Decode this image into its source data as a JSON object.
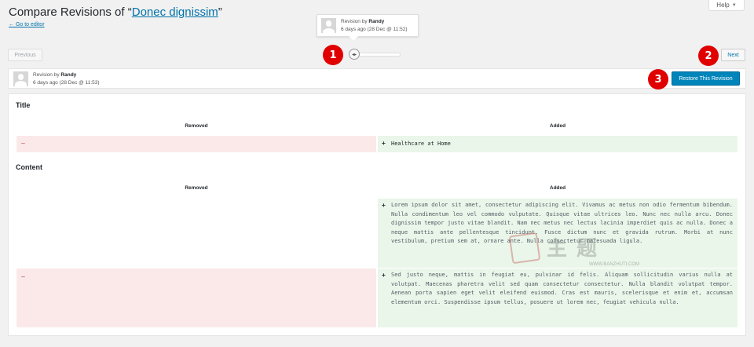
{
  "help": {
    "label": "Help",
    "caret": "▼"
  },
  "header": {
    "title_prefix": "Compare Revisions of “",
    "post_title": "Donec dignissim",
    "title_suffix": "”",
    "go_to_editor": "← Go to editor"
  },
  "tooltip": {
    "label": "Revision by",
    "author": "Randy",
    "time": "6 days ago (28 Dec @ 11:52)"
  },
  "nav": {
    "previous_label": "Previous",
    "next_label": "Next",
    "slider_handle_glyph": "◂▸"
  },
  "badges": [
    "1",
    "2",
    "3"
  ],
  "revision": {
    "label": "Revision by",
    "author": "Randy",
    "time": "6 days ago (28 Dec @ 11:53)",
    "restore_label": "Restore This Revision"
  },
  "diff": {
    "title_section": {
      "heading": "Title",
      "removed_header": "Removed",
      "added_header": "Added",
      "removed_mark": "–",
      "added_mark": "+",
      "added_text": "Healthcare at Home"
    },
    "content_section": {
      "heading": "Content",
      "removed_header": "Removed",
      "added_header": "Added",
      "removed_mark": "–",
      "added_mark": "+",
      "added_paragraph_1": "Lorem ipsum dolor sit amet, consectetur adipiscing elit. Vivamus ac metus non odio fermentum bibendum. Nulla condimentum leo vel commodo vulputate. Quisque vitae ultrices leo. Nunc nec nulla arcu. Donec dignissim tempor justo vitae blandit. Nam nec metus nec lectus lacinia imperdiet quis ac nulla. Donec a neque mattis ante pellentesque tincidunt. Fusce dictum nunc et gravida rutrum. Morbi at nunc vestibulum, pretium sem at, ornare ante. Nulla consectetur malesuada ligula.",
      "added_paragraph_2": "Sed justo neque, mattis in feugiat eu, pulvinar id felis. Aliquam sollicitudin varius nulla at volutpat. Maecenas pharetra velit sed quam consectetur consectetur. Nulla blandit volutpat tempor. Aenean porta sapien eget velit eleifend euismod. Cras est mauris, scelerisque et enim et, accumsan elementum orci. Suspendisse ipsum tellus, posuere ut lorem nec, feugiat vehicula nulla."
    }
  },
  "watermark": {
    "text": "主题",
    "url": "WWW.BANZHUTI.COM"
  }
}
